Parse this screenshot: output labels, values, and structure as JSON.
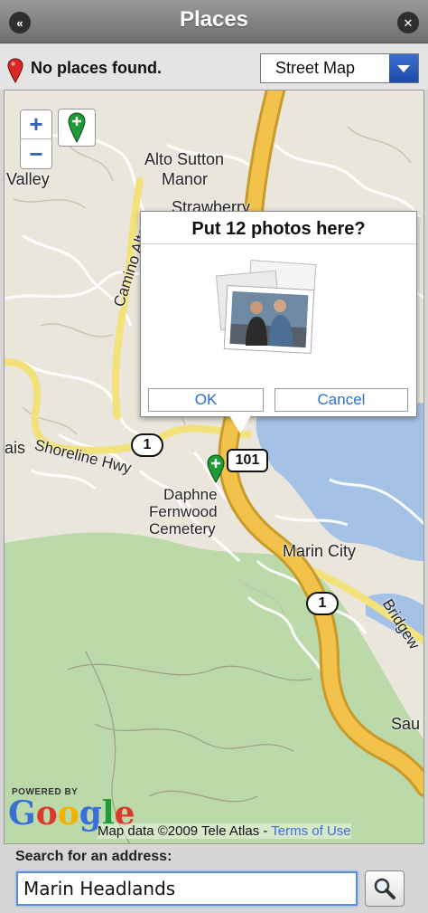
{
  "window": {
    "title": "Places"
  },
  "status": {
    "text": "No places found."
  },
  "map_type": {
    "selected": "Street Map"
  },
  "map": {
    "labels": {
      "valley": "Valley",
      "alto_sutton": "Alto Sutton",
      "manor": "Manor",
      "strawberry": "Strawberry",
      "camino_alto": "Camino Alto",
      "shoreline": "Shoreline Hwy",
      "ais": "ais",
      "daphne": "Daphne",
      "fernwood": "Fernwood",
      "cemetery": "Cemetery",
      "marin_city": "Marin City",
      "bridgeway": "Bridgew",
      "sau": "Sau"
    },
    "shields": {
      "route1_a": "1",
      "route101": "101",
      "route1_b": "1"
    },
    "powered_by": "POWERED BY",
    "google": "Google",
    "copyright": "Map data ©2009 Tele Atlas - ",
    "terms": "Terms of Use"
  },
  "popup": {
    "title": "Put 12 photos here?",
    "ok": "OK",
    "cancel": "Cancel"
  },
  "search": {
    "label": "Search for an address:",
    "value": "Marin Headlands"
  },
  "colors": {
    "accent": "#2a6fd6",
    "highway": "#f2c24a",
    "park": "#bcd9a9",
    "water": "#a4c2e6"
  }
}
